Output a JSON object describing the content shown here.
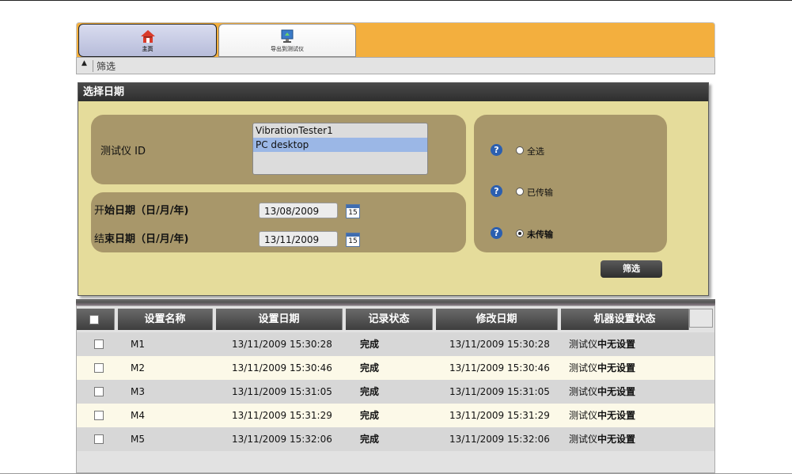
{
  "tabs": {
    "home_label": "主页",
    "export_label": "导出到测试仪"
  },
  "filter": {
    "toggle_label": "筛选"
  },
  "date_panel": {
    "title": "选择日期",
    "tester_id_label": "测试仪 ID",
    "tester_list": [
      "VibrationTester1",
      "PC desktop"
    ],
    "selected_tester": "PC desktop",
    "start_label_a": "开",
    "start_label_b": "始日期（日/月/年)",
    "end_label_a": "结",
    "end_label_b": "束日期（日/月/年)",
    "start_date": "13/08/2009",
    "end_date": "13/11/2009",
    "calendar_day": "15",
    "help_glyph": "?",
    "radio_all": "全选",
    "radio_transferred": "已传输",
    "radio_not_transferred": "未传输",
    "selected_radio": "未传输",
    "filter_button": "筛选"
  },
  "table": {
    "headers": [
      "设置名称",
      "设置日期",
      "记录状态",
      "修改日期",
      "机器设置状态"
    ],
    "rows": [
      {
        "name": "M1",
        "set_date": "13/11/2009 15:30:28",
        "status": "完成",
        "mod_date": "13/11/2009 15:30:28",
        "machine_a": "测试仪",
        "machine_b": "中无设置"
      },
      {
        "name": "M2",
        "set_date": "13/11/2009 15:30:46",
        "status": "完成",
        "mod_date": "13/11/2009 15:30:46",
        "machine_a": "测试仪",
        "machine_b": "中无设置"
      },
      {
        "name": "M3",
        "set_date": "13/11/2009 15:31:05",
        "status": "完成",
        "mod_date": "13/11/2009 15:31:05",
        "machine_a": "测试仪",
        "machine_b": "中无设置"
      },
      {
        "name": "M4",
        "set_date": "13/11/2009 15:31:29",
        "status": "完成",
        "mod_date": "13/11/2009 15:31:29",
        "machine_a": "测试仪",
        "machine_b": "中无设置"
      },
      {
        "name": "M5",
        "set_date": "13/11/2009 15:32:06",
        "status": "完成",
        "mod_date": "13/11/2009 15:32:06",
        "machine_a": "测试仪",
        "machine_b": "中无设置"
      }
    ]
  },
  "colors": {
    "tab_bar": "#f3af3e",
    "panel": "#e5dc9b",
    "panel_box": "#a8976a",
    "header": "#3e3e3e",
    "selected_item": "#9bb7e6"
  },
  "icons": {
    "home": "home-icon",
    "export": "export-to-tester-icon",
    "calendar": "calendar-icon",
    "help": "help-icon"
  }
}
